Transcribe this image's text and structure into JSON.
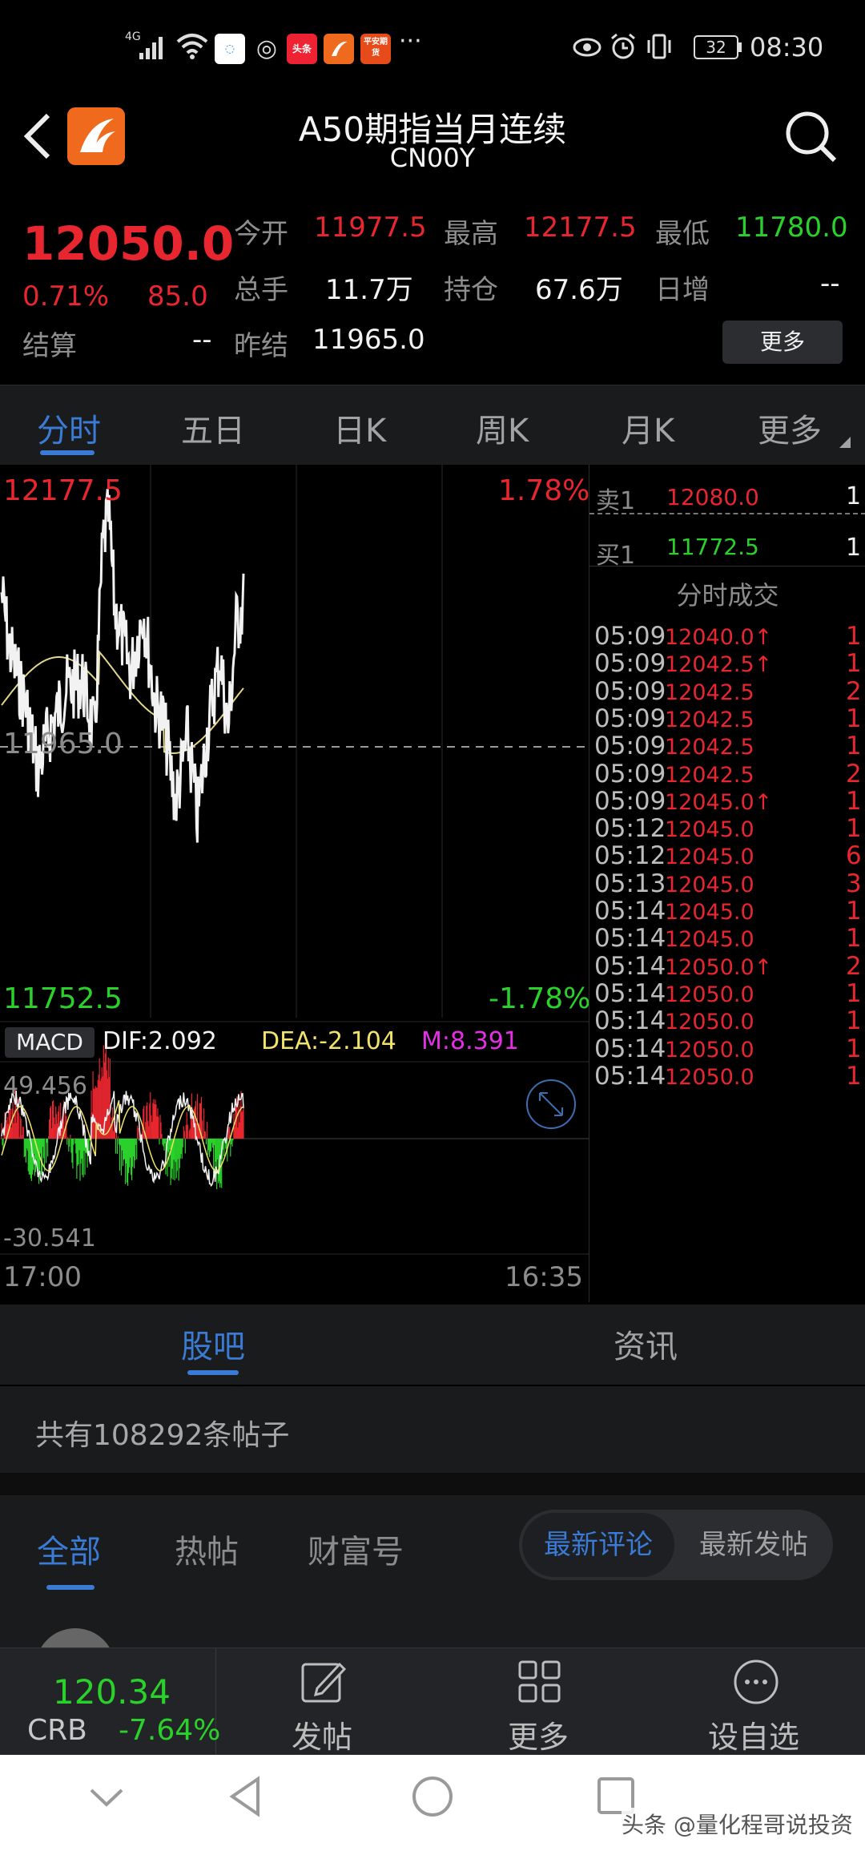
{
  "status_bar": {
    "network": "4G",
    "app_badges": [
      "头条",
      "平安期货"
    ],
    "more": "···",
    "battery": "32",
    "time": "08:30"
  },
  "header": {
    "title": "A50期指当月连续",
    "code": "CN00Y"
  },
  "quote": {
    "price": "12050.0",
    "change_pct": "0.71%",
    "change": "85.0",
    "settle_label": "结算",
    "settle_value": "--",
    "open_label": "今开",
    "open_value": "11977.5",
    "high_label": "最高",
    "high_value": "12177.5",
    "low_label": "最低",
    "low_value": "11780.0",
    "volume_label": "总手",
    "volume_value": "11.7万",
    "oi_label": "持仓",
    "oi_value": "67.6万",
    "daily_inc_label": "日增",
    "daily_inc_value": "--",
    "prev_settle_label": "昨结",
    "prev_settle_value": "11965.0",
    "more_button": "更多"
  },
  "period_tabs": [
    "分时",
    "五日",
    "日K",
    "周K",
    "月K",
    "更多"
  ],
  "chart": {
    "top_price": "12177.5",
    "top_pct": "1.78%",
    "mid_price": "11965.0",
    "bottom_price": "11752.5",
    "bottom_pct": "-1.78%",
    "macd_label": "MACD",
    "dif": "DIF:2.092",
    "dea": "DEA:-2.104",
    "m": "M:8.391",
    "macd_top": "49.456",
    "macd_bottom": "-30.541",
    "time_start": "17:00",
    "time_end": "16:35"
  },
  "orderbook": {
    "sell_label": "卖1",
    "sell_price": "12080.0",
    "sell_qty": "1",
    "buy_label": "买1",
    "buy_price": "11772.5",
    "buy_qty": "1",
    "trades_title": "分时成交",
    "trades": [
      {
        "time": "05:09",
        "price": "12040.0↑",
        "qty": "1"
      },
      {
        "time": "05:09",
        "price": "12042.5↑",
        "qty": "1"
      },
      {
        "time": "05:09",
        "price": "12042.5",
        "qty": "2"
      },
      {
        "time": "05:09",
        "price": "12042.5",
        "qty": "1"
      },
      {
        "time": "05:09",
        "price": "12042.5",
        "qty": "1"
      },
      {
        "time": "05:09",
        "price": "12042.5",
        "qty": "2"
      },
      {
        "time": "05:09",
        "price": "12045.0↑",
        "qty": "1"
      },
      {
        "time": "05:12",
        "price": "12045.0",
        "qty": "1"
      },
      {
        "time": "05:12",
        "price": "12045.0",
        "qty": "6"
      },
      {
        "time": "05:13",
        "price": "12045.0",
        "qty": "3"
      },
      {
        "time": "05:14",
        "price": "12045.0",
        "qty": "1"
      },
      {
        "time": "05:14",
        "price": "12045.0",
        "qty": "1"
      },
      {
        "time": "05:14",
        "price": "12050.0↑",
        "qty": "2"
      },
      {
        "time": "05:14",
        "price": "12050.0",
        "qty": "1"
      },
      {
        "time": "05:14",
        "price": "12050.0",
        "qty": "1"
      },
      {
        "time": "05:14",
        "price": "12050.0",
        "qty": "1"
      },
      {
        "time": "05:14",
        "price": "12050.0",
        "qty": "1"
      }
    ]
  },
  "guba": {
    "tab_forum": "股吧",
    "tab_news": "资讯",
    "post_count": "共有108292条帖子",
    "sub_tabs": [
      "全部",
      "热帖",
      "财富号"
    ],
    "sort_latest_comment": "最新评论",
    "sort_latest_post": "最新发帖"
  },
  "bottom_bar": {
    "ticker_price": "120.34",
    "ticker_name": "CRB",
    "ticker_change": "-7.64%",
    "post_label": "发帖",
    "more_label": "更多",
    "watchlist_label": "设自选"
  },
  "watermark": "头条 @量化程哥说投资",
  "colors": {
    "up": "#e8262f",
    "down": "#2bd12b",
    "accent": "#3a7bd5",
    "avg_line": "#e2d68a",
    "dea_color": "#f1e36a",
    "m_color": "#e62ee6"
  }
}
